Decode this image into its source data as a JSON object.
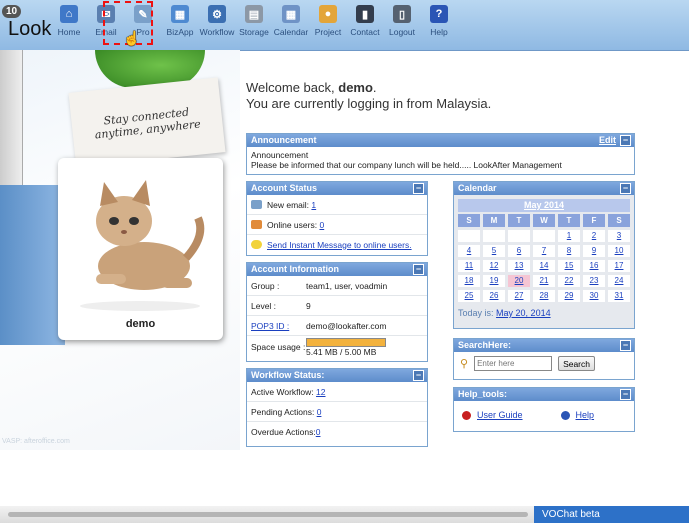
{
  "header": {
    "badge": "10",
    "logo": "Look",
    "nav": [
      {
        "label": "Home",
        "icon": "home-icon",
        "color": "#3f78c8",
        "glyph": "⌂"
      },
      {
        "label": "Email",
        "icon": "email-icon",
        "color": "#5a7fb0",
        "glyph": "✉"
      },
      {
        "label": "Pro",
        "icon": "profile-icon",
        "color": "#7aa0c9",
        "glyph": "✎"
      },
      {
        "label": "BizApp",
        "icon": "bizapp-icon",
        "color": "#4e8ad1",
        "glyph": "▦"
      },
      {
        "label": "Workflow",
        "icon": "workflow-icon",
        "color": "#3b6fb2",
        "glyph": "⚙"
      },
      {
        "label": "Storage",
        "icon": "storage-icon",
        "color": "#8c98a6",
        "glyph": "▤"
      },
      {
        "label": "Calendar",
        "icon": "calendar-icon",
        "color": "#6f93c6",
        "glyph": "▦"
      },
      {
        "label": "Project",
        "icon": "project-icon",
        "color": "#e3a53a",
        "glyph": "●"
      },
      {
        "label": "Contact",
        "icon": "contact-icon",
        "color": "#333d4d",
        "glyph": "▮"
      },
      {
        "label": "Logout",
        "icon": "logout-icon",
        "color": "#556170",
        "glyph": "▯"
      },
      {
        "label": "Help",
        "icon": "help-icon",
        "color": "#2a55b5",
        "glyph": "?"
      }
    ]
  },
  "deco": {
    "note_line1": "Stay connected",
    "note_line2": "anytime, anywhere",
    "profile_name": "demo",
    "watermark": "VASP: afteroffice.com"
  },
  "welcome": {
    "line1_prefix": "Welcome back, ",
    "user": "demo",
    "line1_suffix": ".",
    "line2": "You are currently logging in from Malaysia."
  },
  "announcement": {
    "title": "Announcement",
    "edit": "Edit",
    "heading": "Announcement",
    "text": "Please be informed that our company lunch will be held..... LookAfter Management"
  },
  "account_status": {
    "title": "Account Status",
    "new_email_label": "New email:",
    "new_email_count": "1",
    "online_users_label": "Online users:",
    "online_users_count": "0",
    "send_im": "Send Instant Message to online users."
  },
  "account_info": {
    "title": "Account Information",
    "group_label": "Group :",
    "group_value": "team1, user, voadmin",
    "level_label": "Level :",
    "level_value": "9",
    "pop3_label": "POP3 ID :",
    "pop3_value": "demo@lookafter.com",
    "space_label": "Space usage :",
    "space_value": "5.41 MB / 5.00 MB",
    "space_fraction": 1.0
  },
  "workflow": {
    "title": "Workflow Status:",
    "active_label": "Active Workflow:",
    "active_count": "12",
    "pending_label": "Pending Actions:",
    "pending_count": "0",
    "overdue_label": "Overdue Actions:",
    "overdue_count": "0"
  },
  "calendar": {
    "title": "Calendar",
    "month": "May 2014",
    "weekdays": [
      "S",
      "M",
      "T",
      "W",
      "T",
      "F",
      "S"
    ],
    "weeks": [
      [
        "",
        "",
        "",
        "",
        "1",
        "2",
        "3"
      ],
      [
        "4",
        "5",
        "6",
        "7",
        "8",
        "9",
        "10"
      ],
      [
        "11",
        "12",
        "13",
        "14",
        "15",
        "16",
        "17"
      ],
      [
        "18",
        "19",
        "20",
        "21",
        "22",
        "23",
        "24"
      ],
      [
        "25",
        "26",
        "27",
        "28",
        "29",
        "30",
        "31"
      ]
    ],
    "today_day": "20",
    "today_label": "Today is:",
    "today_value": "May 20, 2014"
  },
  "search": {
    "title": "SearchHere:",
    "placeholder": "Enter here",
    "button": "Search"
  },
  "help_tools": {
    "title": "Help_tools:",
    "user_guide": "User Guide",
    "help": "Help"
  },
  "vochat": "VOChat beta"
}
